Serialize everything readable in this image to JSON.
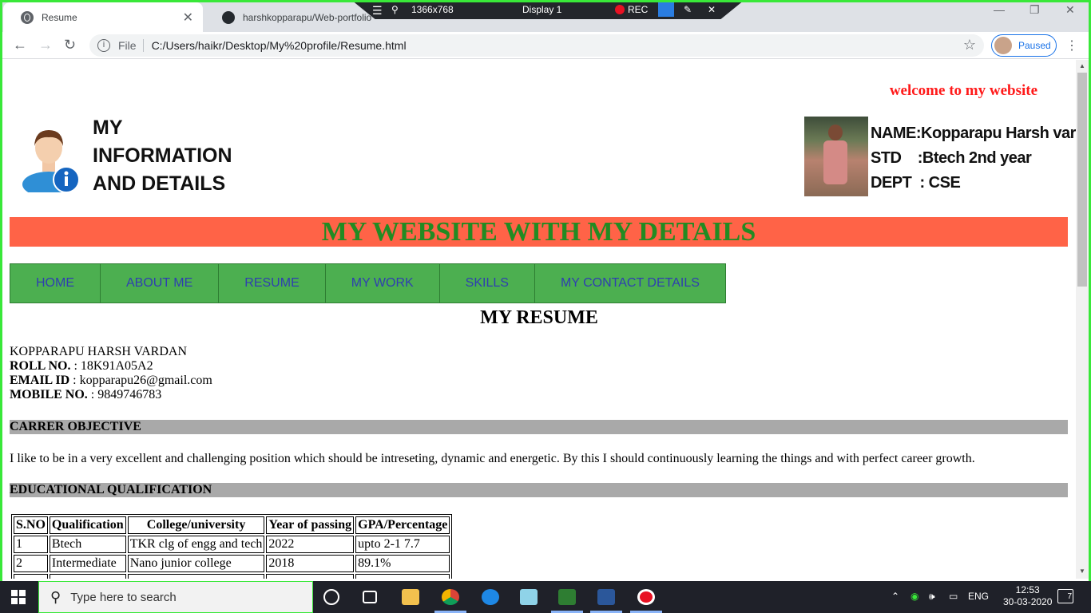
{
  "browser": {
    "tabs": [
      {
        "title": "Resume",
        "favicon": "globe-icon",
        "active": true
      },
      {
        "title": "harshkopparapu/Web-portfolio",
        "favicon": "github-icon",
        "active": false
      }
    ],
    "address": {
      "scheme": "File",
      "url": "C:/Users/haikr/Desktop/My%20profile/Resume.html"
    },
    "profile_label": "Paused"
  },
  "recorder": {
    "resolution": "1366x768",
    "display": "Display 1",
    "rec": "REC"
  },
  "page": {
    "welcome": "welcome to my website",
    "info_title": [
      "MY",
      "INFORMATION",
      "AND DETAILS"
    ],
    "details": [
      "NAME:Kopparapu Harsh vardan",
      "STD    :Btech 2nd year",
      "DEPT  : CSE"
    ],
    "banner": "MY WEBSITE WITH MY DETAILS",
    "nav": [
      "HOME",
      "ABOUT ME",
      "RESUME",
      "MY WORK",
      "SKILLS",
      "MY CONTACT DETAILS"
    ],
    "heading": "MY RESUME",
    "contact": {
      "name": "KOPPARAPU HARSH VARDAN",
      "roll_label": "ROLL NO.",
      "roll": " : 18K91A05A2",
      "email_label": "EMAIL ID",
      "email": " : kopparapu26@gmail.com",
      "mobile_label": "MOBILE NO.",
      "mobile": " : 9849746783"
    },
    "objective_heading": "CARRER OBJECTIVE",
    "objective": "I like to be in a very excellent and challenging position which should be intreseting, dynamic and energetic. By this I should continuously learning the things and with perfect career growth.",
    "education_heading": "EDUCATIONAL QUALIFICATION",
    "education": {
      "headers": [
        "S.NO",
        "Qualification",
        "College/university",
        "Year of passing",
        "GPA/Percentage"
      ],
      "rows": [
        [
          "1",
          "Btech",
          "TKR clg of engg and tech",
          "2022",
          "upto 2-1 7.7"
        ],
        [
          "2",
          "Intermediate",
          "Nano junior college",
          "2018",
          "89.1%"
        ],
        [
          "",
          "",
          "",
          "",
          ""
        ]
      ]
    }
  },
  "taskbar": {
    "search_placeholder": "Type here to search",
    "language": "ENG",
    "time": "12:53",
    "date": "30-03-2020",
    "notifications": "7"
  },
  "colors": {
    "accent_border": "#39e839",
    "banner_bg": "#ff6347",
    "banner_text": "#228b22",
    "nav_bg": "#4caf50",
    "welcome": "#ff1a1a"
  }
}
